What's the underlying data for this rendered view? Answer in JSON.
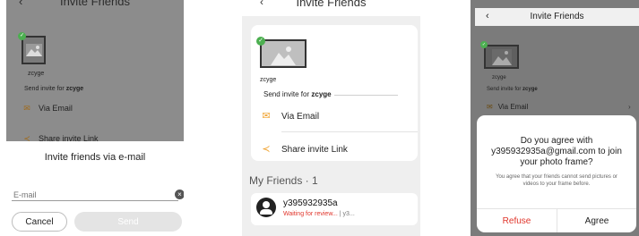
{
  "colors": {
    "accent_orange": "#f0a12c",
    "refuse_red": "#e0352b",
    "check_green": "#4caf50",
    "overlay_gray": "#7b7b7b"
  },
  "panel1": {
    "header": {
      "back_glyph": "‹",
      "title": "Invite Friends"
    },
    "frame": {
      "name": "zcyge",
      "send_invite_prefix": "Send invite for",
      "send_invite_name": "zcyge"
    },
    "options": {
      "email_label": "Via Email",
      "share_label": "Share invite Link"
    },
    "sheet": {
      "title": "Invite friends via e-mail",
      "email_placeholder": "E-mail",
      "clear_glyph": "×",
      "cancel_label": "Cancel",
      "send_label": "Send"
    }
  },
  "panel2": {
    "header": {
      "back_glyph": "‹",
      "title": "Invite Friends"
    },
    "frame": {
      "name": "zcyge",
      "send_invite_prefix": "Send invite for",
      "send_invite_name": "zcyge"
    },
    "options": {
      "email_label": "Via Email",
      "share_label": "Share invite Link"
    },
    "friends": {
      "heading": "My Friends · 1",
      "items": [
        {
          "email": "y395932935a",
          "status": "Waiting for review...",
          "status_rest": " | y3..."
        }
      ]
    }
  },
  "panel3": {
    "header": {
      "back_glyph": "‹",
      "title": "Invite Friends"
    },
    "frame": {
      "name": "zcyge",
      "send_invite_prefix": "Send invite for",
      "send_invite_name": "zcyge"
    },
    "options": {
      "email_label": "Via Email"
    },
    "dialog": {
      "close_glyph": "×",
      "question_line1": "Do you agree with",
      "question_line2": "y395932935a@gmail.com to join",
      "question_line3": "your photo frame?",
      "note_line1": "You agree that your friends cannot send pictures or",
      "note_line2": "videos to your frame before.",
      "refuse_label": "Refuse",
      "agree_label": "Agree"
    }
  }
}
